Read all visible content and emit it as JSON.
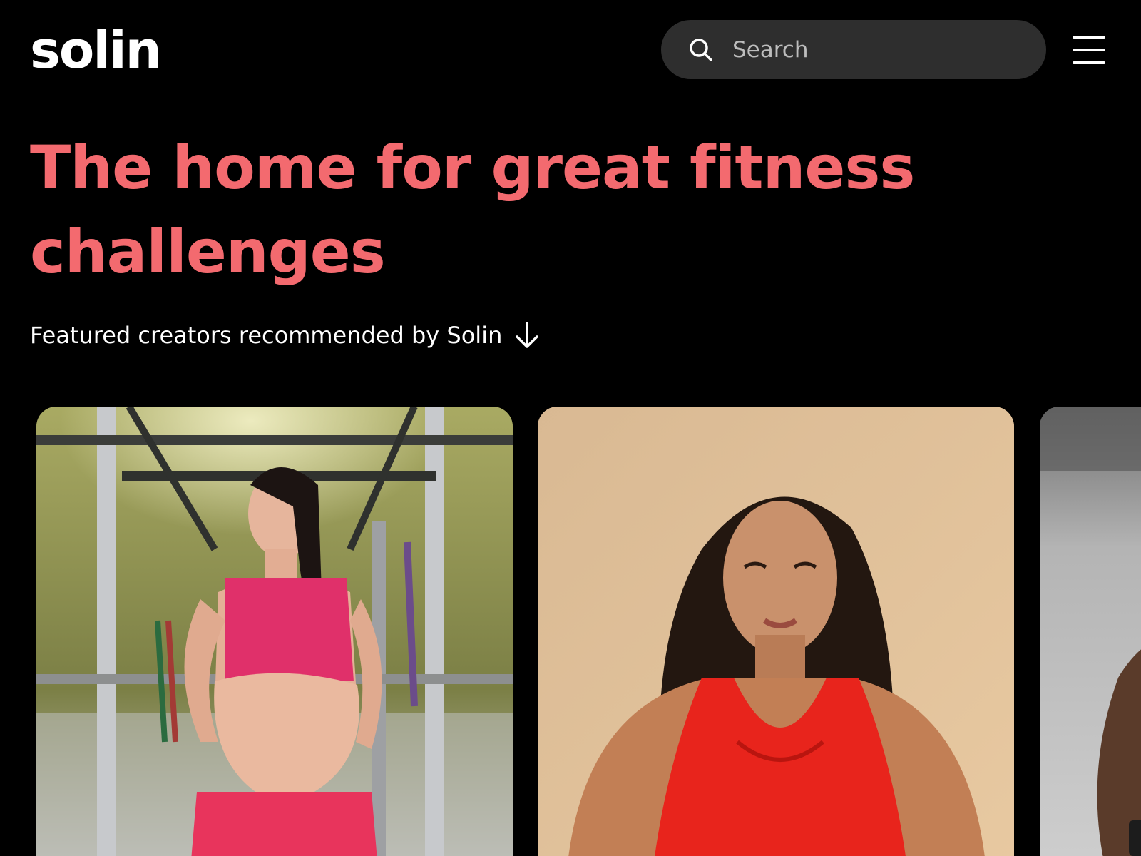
{
  "brand": {
    "logo_text": "solin"
  },
  "header": {
    "search": {
      "placeholder": "Search",
      "icon": "search-icon"
    },
    "menu_icon": "hamburger-menu-icon"
  },
  "hero": {
    "title": "The home for great fitness challenges"
  },
  "featured": {
    "label": "Featured creators recommended by Solin",
    "icon": "arrow-down-icon"
  },
  "creator_cards": [
    {
      "image": "creator-photo-gym"
    },
    {
      "image": "creator-photo-red-top"
    },
    {
      "image": "creator-photo-outdoor"
    }
  ],
  "colors": {
    "background": "#000000",
    "accent": "#f36a6f",
    "search_bg": "#2e2e2e",
    "text": "#ffffff"
  }
}
